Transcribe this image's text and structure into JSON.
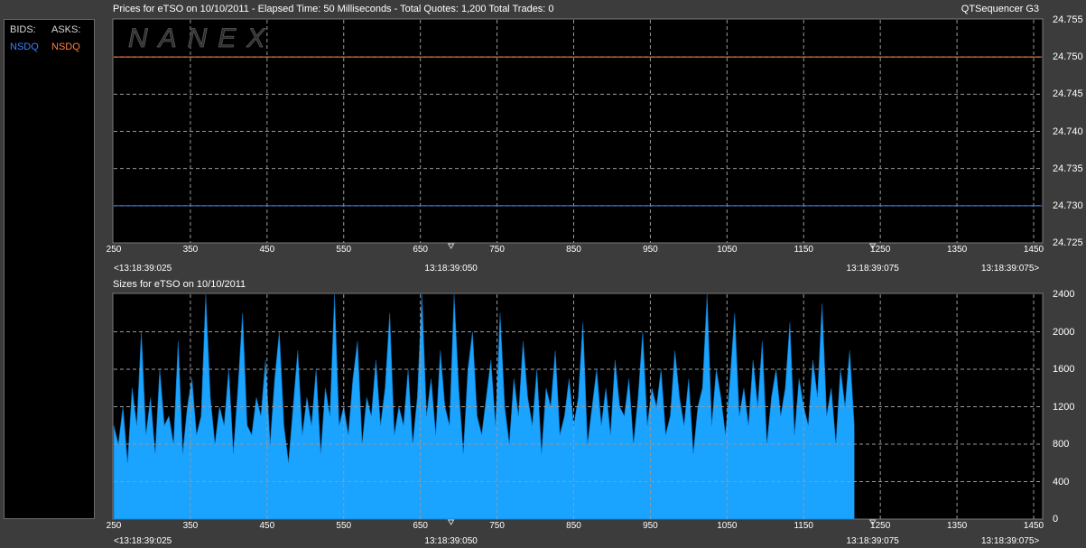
{
  "header": {
    "title": "Prices for  eTSO  on  10/10/2011  -  Elapsed Time: 50 Milliseconds  -  Total Quotes: 1,200  Total Trades: 0",
    "app_name": "QTSequencer G3"
  },
  "legend": {
    "bids_label": "BIDS:",
    "asks_label": "ASKS:",
    "bids_exchange": "NSDQ",
    "asks_exchange": "NSDQ",
    "bids_color": "#3f7fff",
    "asks_color": "#ff8040"
  },
  "watermark": "NANEX",
  "x_axis": {
    "ticks": [
      250,
      350,
      450,
      550,
      650,
      750,
      850,
      950,
      1050,
      1150,
      1250,
      1350,
      1450
    ],
    "range": [
      250,
      1450
    ],
    "timestamps": [
      {
        "text": "<13:18:39:025",
        "at": 250
      },
      {
        "text": "13:18:39:050",
        "at": 690
      },
      {
        "text": "13:18:39:075",
        "at": 1240
      },
      {
        "text": "13:18:39:075>",
        "at": 1450
      }
    ],
    "markers": [
      690,
      1240
    ]
  },
  "chart_data": [
    {
      "type": "line",
      "title": "Prices for  eTSO  on  10/10/2011",
      "ylim": [
        24.725,
        24.755
      ],
      "yticks": [
        "24.755",
        "24.750",
        "24.745",
        "24.740",
        "24.735",
        "24.730",
        "24.725"
      ],
      "xlim": [
        250,
        1450
      ],
      "series": [
        {
          "name": "ASKS NSDQ",
          "color": "#ff8040",
          "x": [
            250,
            1450
          ],
          "values": [
            24.75,
            24.75
          ]
        },
        {
          "name": "BIDS NSDQ",
          "color": "#3f7fff",
          "x": [
            250,
            1450
          ],
          "values": [
            24.73,
            24.73
          ]
        }
      ],
      "grid": true
    },
    {
      "type": "area",
      "title": "Sizes for  eTSO  on  10/10/2011",
      "ylim": [
        0,
        2400
      ],
      "yticks": [
        "2400",
        "2000",
        "1600",
        "1200",
        "800",
        "400",
        "0"
      ],
      "xlim": [
        250,
        1450
      ],
      "series": [
        {
          "name": "Bid Size",
          "color": "#1aa3ff",
          "x_start": 250,
          "x_step": 6,
          "values": [
            1000,
            800,
            1200,
            600,
            1400,
            1000,
            2000,
            900,
            1300,
            700,
            1600,
            1000,
            1100,
            800,
            1900,
            700,
            1200,
            1500,
            900,
            1100,
            2400,
            1300,
            800,
            1200,
            1000,
            1600,
            700,
            1400,
            2200,
            1000,
            900,
            1300,
            1100,
            1700,
            800,
            1500,
            2000,
            1000,
            600,
            1200,
            1800,
            900,
            1300,
            1000,
            1600,
            700,
            1400,
            1100,
            2400,
            1000,
            1200,
            900,
            1500,
            1900,
            800,
            1300,
            1100,
            1700,
            1000,
            1400,
            2200,
            900,
            1200,
            1000,
            1600,
            800,
            1300,
            2400,
            1100,
            1500,
            900,
            1800,
            1200,
            1000,
            2400,
            1400,
            700,
            1600,
            2000,
            1100,
            900,
            1300,
            1700,
            1000,
            2200,
            1200,
            800,
            1500,
            1100,
            1900,
            1300,
            1000,
            1600,
            700,
            1400,
            1200,
            1800,
            900,
            1100,
            1500,
            1000,
            1300,
            2100,
            800,
            1200,
            1600,
            1000,
            1400,
            900,
            1700,
            1200,
            1100,
            1500,
            800,
            1300,
            2000,
            1000,
            1400,
            1200,
            1600,
            900,
            1100,
            1800,
            1300,
            1000,
            1500,
            700,
            1200,
            1400,
            2400,
            1000,
            1600,
            1300,
            900,
            1500,
            2200,
            1100,
            1400,
            1000,
            1700,
            1200,
            1900,
            800,
            1300,
            1600,
            1100,
            1400,
            2100,
            900,
            1500,
            1200,
            1000,
            1700,
            1300,
            2300,
            1100,
            1400,
            800,
            1600,
            1200,
            1800,
            1000
          ]
        }
      ],
      "grid": true
    }
  ]
}
